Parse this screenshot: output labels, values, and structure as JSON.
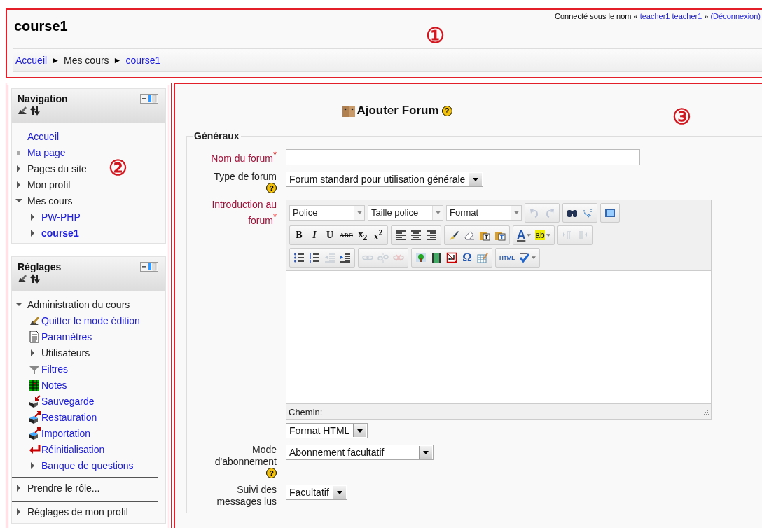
{
  "header": {
    "title": "course1",
    "callout": "①",
    "login": [
      {
        "text": "Connecté sous le nom «",
        "link": false
      },
      {
        "text": "teacher1 teacher1",
        "link": true
      },
      {
        "text": "»",
        "link": false
      },
      {
        "text": "(Déconnexion)",
        "link": true
      }
    ],
    "breadcrumb": [
      {
        "text": "Accueil",
        "kind": "link"
      },
      {
        "text": "►",
        "kind": "separator"
      },
      {
        "text": "Mes cours",
        "kind": "text"
      },
      {
        "text": "►",
        "kind": "separator"
      },
      {
        "text": "course1",
        "kind": "link"
      }
    ]
  },
  "sidebar": {
    "callout": "②",
    "blocks": [
      {
        "title": "Navigation",
        "divided": false,
        "items": [
          {
            "label": "Accueil",
            "kind": "none",
            "link": true,
            "current": false
          },
          {
            "label": "Ma page",
            "kind": "bullet",
            "link": true,
            "current": false
          },
          {
            "label": "Pages du site",
            "kind": "branch",
            "expanded": false,
            "link": false,
            "current": false
          },
          {
            "label": "Mon profil",
            "kind": "branch",
            "expanded": false,
            "link": false,
            "current": false
          },
          {
            "label": "Mes cours",
            "kind": "branch",
            "expanded": true,
            "link": false,
            "current": false,
            "children": [
              {
                "label": "PW-PHP",
                "kind": "branch",
                "expanded": false,
                "link": true,
                "current": false
              },
              {
                "label": "course1",
                "kind": "branch",
                "expanded": false,
                "link": true,
                "current": true
              }
            ]
          }
        ]
      },
      {
        "title": "Réglages",
        "divided": true,
        "items": [
          {
            "label": "Administration du cours",
            "kind": "branch",
            "expanded": true,
            "link": false,
            "current": false,
            "children": [
              {
                "label": "Quitter le mode édition",
                "kind": "edit",
                "link": true,
                "current": false
              },
              {
                "label": "Paramètres",
                "kind": "document",
                "link": true,
                "current": false
              },
              {
                "label": "Utilisateurs",
                "kind": "branch",
                "expanded": false,
                "link": false,
                "current": false
              },
              {
                "label": "Filtres",
                "kind": "filter",
                "link": true,
                "current": false
              },
              {
                "label": "Notes",
                "kind": "grades",
                "link": true,
                "current": false
              },
              {
                "label": "Sauvegarde",
                "kind": "backup",
                "link": true,
                "current": false
              },
              {
                "label": "Restauration",
                "kind": "restore",
                "link": true,
                "current": false
              },
              {
                "label": "Importation",
                "kind": "import",
                "link": true,
                "current": false
              },
              {
                "label": "Réinitialisation",
                "kind": "reset",
                "link": true,
                "current": false
              },
              {
                "label": "Banque de questions",
                "kind": "branch",
                "expanded": false,
                "link": true,
                "current": false
              }
            ]
          },
          {
            "label": "Prendre le rôle...",
            "kind": "branch",
            "expanded": false,
            "link": false,
            "current": false
          },
          {
            "label": "Réglages de mon profil",
            "kind": "branch",
            "expanded": false,
            "link": false,
            "current": false
          }
        ]
      }
    ]
  },
  "main": {
    "callout": "③",
    "title": "Ajouter Forum",
    "help": "?",
    "legend": "Généraux",
    "fields": [
      {
        "label": "Nom du forum$^{*}$",
        "required": true,
        "kind": "text"
      },
      {
        "label": "Type de forum",
        "required": false,
        "help": "?",
        "kind": "select",
        "value": "Forum standard pour utilisation générale"
      },
      {
        "label": "Introduction au forum$^{*}$",
        "required": true,
        "kind": "editor",
        "path": "Chemin:",
        "format": "Format HTML",
        "toolbar": [
          [
            {
              "kind": "select",
              "label": "Police"
            },
            {
              "kind": "select",
              "label": "Taille police"
            },
            {
              "kind": "select",
              "label": "Format"
            },
            {
              "kind": "group",
              "buttons": [
                {
                  "kind": "undo",
                  "disabled": true
                },
                {
                  "kind": "redo",
                  "disabled": true
                }
              ]
            },
            {
              "kind": "group",
              "buttons": [
                {
                  "kind": "find",
                  "disabled": false
                },
                {
                  "kind": "replace",
                  "disabled": false
                }
              ]
            },
            {
              "kind": "group",
              "buttons": [
                {
                  "kind": "fullscreen",
                  "disabled": false
                }
              ]
            }
          ],
          [
            {
              "kind": "group",
              "buttons": [
                {
                  "kind": "bold",
                  "label": "B",
                  "disabled": false
                },
                {
                  "kind": "italic",
                  "label": "I",
                  "disabled": false
                },
                {
                  "kind": "underline",
                  "label": "U",
                  "disabled": false
                },
                {
                  "kind": "strike",
                  "label": "ABC",
                  "disabled": false
                },
                {
                  "kind": "subscript",
                  "label": "x$_{2}$",
                  "disabled": false
                },
                {
                  "kind": "superscript",
                  "label": "x$^{2}$",
                  "disabled": false
                }
              ]
            },
            {
              "kind": "group",
              "buttons": [
                {
                  "kind": "alignleft",
                  "disabled": false
                },
                {
                  "kind": "aligncenter",
                  "disabled": false
                },
                {
                  "kind": "alignright",
                  "disabled": false
                }
              ]
            },
            {
              "kind": "group",
              "buttons": [
                {
                  "kind": "brush",
                  "disabled": false
                },
                {
                  "kind": "eraser",
                  "disabled": false
                },
                {
                  "kind": "pastetext",
                  "disabled": false
                },
                {
                  "kind": "pasteword",
                  "disabled": false
                }
              ]
            },
            {
              "kind": "group",
              "buttons": [
                {
                  "kind": "color",
                  "label": "A",
                  "dropdown": true,
                  "disabled": false
                },
                {
                  "kind": "highlight",
                  "label": "ab",
                  "dropdown": true,
                  "disabled": false
                }
              ]
            },
            {
              "kind": "group",
              "buttons": [
                {
                  "kind": "ltr",
                  "disabled": true
                },
                {
                  "kind": "rtl",
                  "disabled": true
                }
              ]
            }
          ],
          [
            {
              "kind": "group",
              "buttons": [
                {
                  "kind": "bullist",
                  "disabled": false
                },
                {
                  "kind": "numlist",
                  "disabled": false
                },
                {
                  "kind": "outdent",
                  "disabled": true
                },
                {
                  "kind": "indent",
                  "disabled": false
                }
              ]
            },
            {
              "kind": "group",
              "buttons": [
                {
                  "kind": "link",
                  "disabled": true
                },
                {
                  "kind": "unlink",
                  "disabled": true
                },
                {
                  "kind": "anchor",
                  "disabled": true
                }
              ]
            },
            {
              "kind": "group",
              "buttons": [
                {
                  "kind": "image",
                  "disabled": false
                },
                {
                  "kind": "media",
                  "disabled": false
                },
                {
                  "kind": "nonbreaking",
                  "disabled": false
                },
                {
                  "kind": "symbol",
                  "label": "Ω",
                  "disabled": false
                },
                {
                  "kind": "table",
                  "disabled": false
                }
              ]
            },
            {
              "kind": "group",
              "buttons": [
                {
                  "kind": "html",
                  "label": "HTML",
                  "disabled": false
                },
                {
                  "kind": "spellcheck",
                  "dropdown": true,
                  "disabled": false
                }
              ]
            }
          ]
        ]
      },
      {
        "label": "Mode d'abonnement",
        "required": false,
        "help": "?",
        "kind": "select",
        "value": "Abonnement facultatif"
      },
      {
        "label": "Suivi des messages lus",
        "required": false,
        "kind": "select",
        "value": "Facultatif"
      }
    ]
  }
}
